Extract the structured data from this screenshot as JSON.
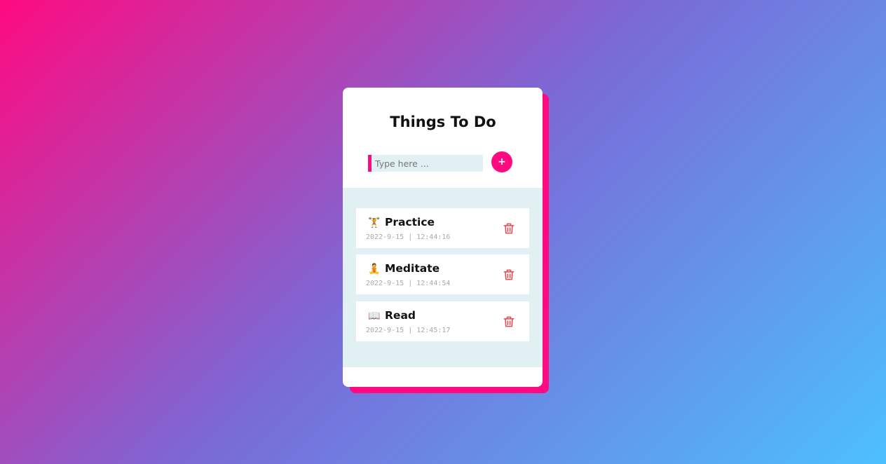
{
  "app": {
    "title": "Things To Do",
    "input_placeholder": "Type here ...",
    "add_label": "+"
  },
  "colors": {
    "accent": "#ff0a80",
    "list_bg": "#e1f0f3",
    "trash": "#e8454f"
  },
  "tasks": [
    {
      "emoji": "🏋️",
      "label": "Practice",
      "time": "2022-9-15 | 12:44:16",
      "icon": "trash-icon"
    },
    {
      "emoji": "🧘",
      "label": "Meditate",
      "time": "2022-9-15 | 12:44:54",
      "icon": "trash-icon"
    },
    {
      "emoji": "📖",
      "label": "Read",
      "time": "2022-9-15 | 12:45:17",
      "icon": "trash-icon"
    }
  ]
}
